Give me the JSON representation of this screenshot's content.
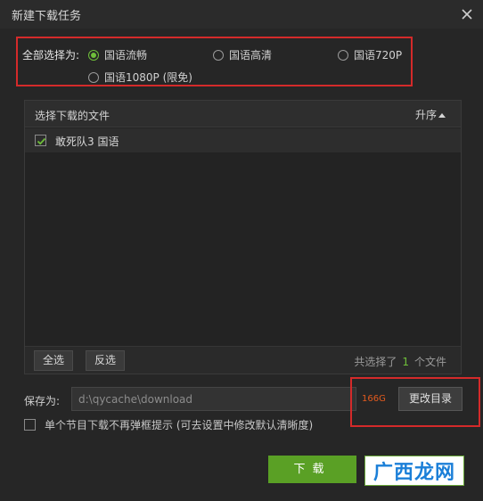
{
  "window": {
    "title": "新建下载任务"
  },
  "quality": {
    "label": "全部选择为:",
    "options": [
      {
        "label": "国语流畅",
        "checked": true
      },
      {
        "label": "国语高清",
        "checked": false
      },
      {
        "label": "国语720P",
        "checked": false
      },
      {
        "label": "国语1080P (限免)",
        "checked": false
      }
    ]
  },
  "files": {
    "header": "选择下载的文件",
    "sort_label": "升序",
    "items": [
      {
        "name": "敢死队3 国语",
        "checked": true
      }
    ],
    "select_all": "全选",
    "invert_select": "反选",
    "summary_prefix": "共选择了",
    "summary_count": "1",
    "summary_suffix": "个文件"
  },
  "save": {
    "label": "保存为:",
    "path": "d:\\qycache\\download",
    "space": "166G",
    "change_dir_label": "更改目录"
  },
  "no_popup": {
    "label": "单个节目下载不再弹框提示 (可去设置中修改默认清晰度)",
    "checked": false
  },
  "download_button": "下载",
  "watermark_text": "广西龙网",
  "colors": {
    "accent_green": "#5aa025",
    "highlight_red": "#d42a2a",
    "space_orange": "#e35a1e"
  }
}
